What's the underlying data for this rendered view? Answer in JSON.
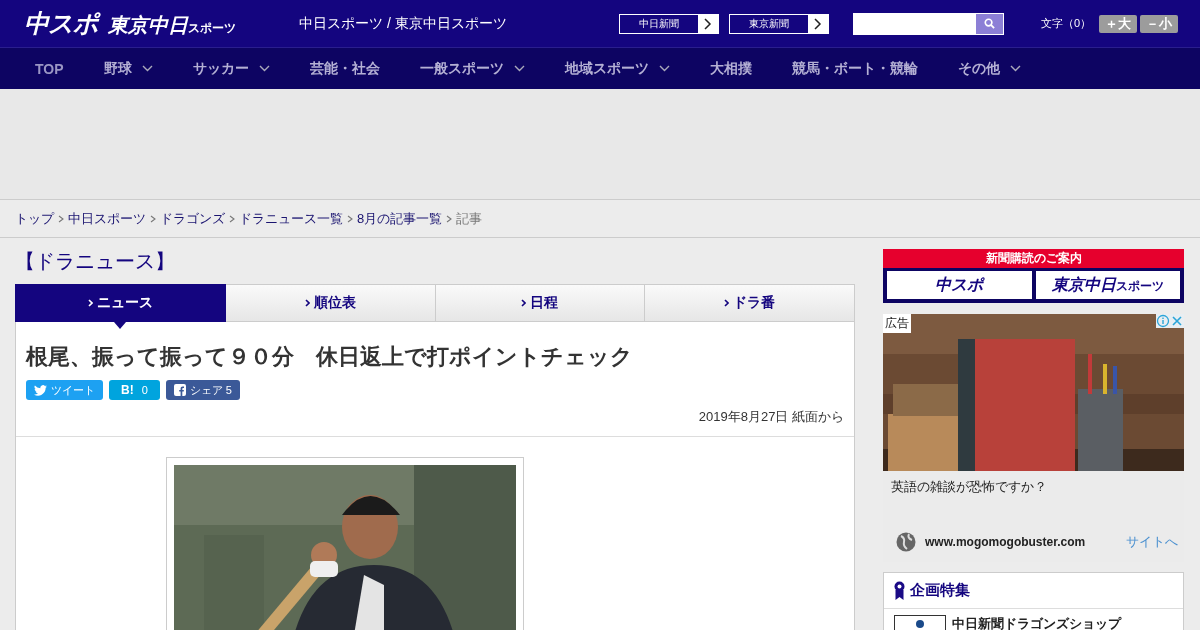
{
  "header": {
    "logo_main": "中スポ",
    "logo_sub": "東京中日",
    "logo_sub_small": "スポーツ",
    "tagline": "中日スポーツ / 東京中日スポーツ",
    "links": [
      {
        "label": "中日新聞"
      },
      {
        "label": "東京新聞"
      }
    ],
    "search": {
      "has_button": true
    },
    "font_size": {
      "label": "文字（0）",
      "buttons": [
        "＋大",
        "－小"
      ]
    }
  },
  "nav": [
    {
      "label": "TOP",
      "dropdown": false,
      "selected": true
    },
    {
      "label": "野球",
      "dropdown": true,
      "selected": false
    },
    {
      "label": "サッカー",
      "dropdown": true,
      "selected": false
    },
    {
      "label": "芸能・社会",
      "dropdown": false,
      "selected": false
    },
    {
      "label": "一般スポーツ",
      "dropdown": true,
      "selected": false
    },
    {
      "label": "地域スポーツ",
      "dropdown": true,
      "selected": false
    },
    {
      "label": "大相撲",
      "dropdown": false,
      "selected": false
    },
    {
      "label": "競馬・ボート・競輪",
      "dropdown": false,
      "selected": false
    },
    {
      "label": "その他",
      "dropdown": true,
      "selected": false
    }
  ],
  "breadcrumb": [
    {
      "label": "トップ",
      "kind": "link"
    },
    {
      "label": "中日スポーツ",
      "kind": "link"
    },
    {
      "label": "ドラゴンズ",
      "kind": "link"
    },
    {
      "label": "ドラニュース一覧",
      "kind": "link"
    },
    {
      "label": "8月の記事一覧",
      "kind": "link"
    },
    {
      "label": "記事",
      "kind": "current"
    }
  ],
  "section_title": "【ドラニュース】",
  "tabs": [
    {
      "label": "ニュース",
      "selected": true
    },
    {
      "label": "順位表",
      "selected": false
    },
    {
      "label": "日程",
      "selected": false
    },
    {
      "label": "ドラ番",
      "selected": false
    }
  ],
  "article": {
    "title": "根尾、振って振って９０分　休日返上で打ポイントチェック",
    "share": [
      {
        "kind": "twitter",
        "label": "ツイート"
      },
      {
        "kind": "hatena",
        "mark": "B!",
        "label": "0"
      },
      {
        "kind": "facebook",
        "label": "シェア 5"
      }
    ],
    "date": "2019年8月27日 紙面から"
  },
  "sidebar": {
    "subscribe": {
      "heading": "新聞購読のご案内",
      "logos": [
        {
          "main": "中スポ"
        },
        {
          "main": "東京中日",
          "small": "スポーツ"
        }
      ]
    },
    "ad": {
      "badge": "広告",
      "headline": "英語の雑談が恐怖ですか？",
      "url": "www.mogomogobuster.com",
      "link": "サイトへ"
    },
    "feature": {
      "heading": "企画特集",
      "items": [
        "中日新聞ドラゴンズショップ"
      ]
    }
  }
}
